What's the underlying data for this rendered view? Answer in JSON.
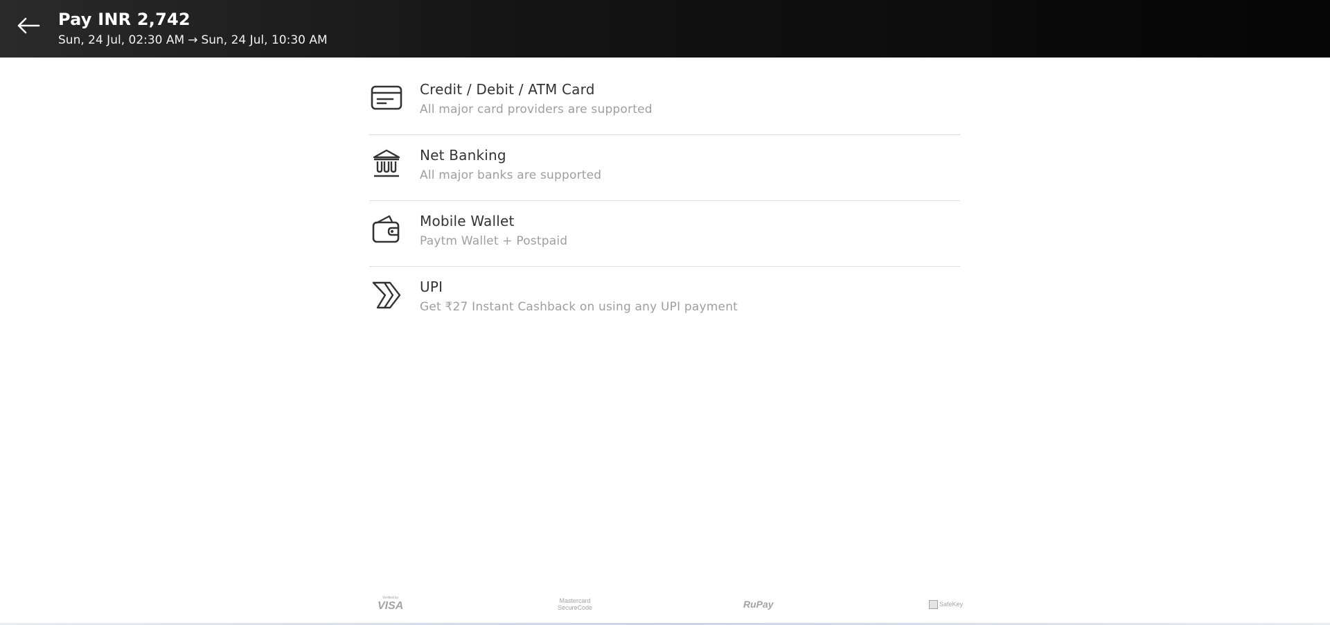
{
  "header": {
    "title": "Pay INR 2,742",
    "depart": "Sun, 24 Jul, 02:30 AM",
    "arrow": "→",
    "arrive": "Sun, 24 Jul, 10:30 AM",
    "back_icon": "arrow-left-icon"
  },
  "methods": [
    {
      "icon": "card-icon",
      "title": "Credit / Debit / ATM Card",
      "subtitle": "All major card providers are supported"
    },
    {
      "icon": "bank-icon",
      "title": "Net Banking",
      "subtitle": "All major banks are supported"
    },
    {
      "icon": "wallet-icon",
      "title": "Mobile Wallet",
      "subtitle": "Paytm Wallet + Postpaid"
    },
    {
      "icon": "upi-icon",
      "title": "UPI",
      "subtitle": "Get ₹27 Instant Cashback on using any UPI payment"
    }
  ],
  "footer": {
    "visa_small": "Verified by",
    "visa": "VISA",
    "mastercard_line1": "Mastercard",
    "mastercard_line2": "SecureCode",
    "rupay": "RuPay",
    "safekey": "SafeKey"
  },
  "colors": {
    "header_bg": "#141414",
    "subtitle_text": "#9e9e9e",
    "divider": "#dcdcdc"
  }
}
